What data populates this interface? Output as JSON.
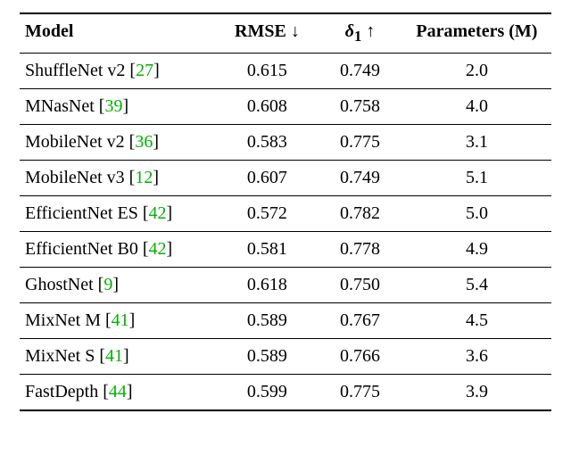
{
  "headers": {
    "model": "Model",
    "rmse": "RMSE",
    "rmse_arrow": "↓",
    "delta": "δ",
    "delta_sub": "1",
    "delta_arrow": "↑",
    "params": "Parameters (M)"
  },
  "rows": [
    {
      "name": "ShuffleNet v2",
      "cite": "27",
      "rmse": "0.615",
      "delta": "0.749",
      "params": "2.0"
    },
    {
      "name": "MNasNet",
      "cite": "39",
      "rmse": "0.608",
      "delta": "0.758",
      "params": "4.0"
    },
    {
      "name": "MobileNet v2",
      "cite": "36",
      "rmse": "0.583",
      "delta": "0.775",
      "params": "3.1"
    },
    {
      "name": "MobileNet v3",
      "cite": "12",
      "rmse": "0.607",
      "delta": "0.749",
      "params": "5.1"
    },
    {
      "name": "EfficientNet ES",
      "cite": "42",
      "rmse": "0.572",
      "delta": "0.782",
      "params": "5.0"
    },
    {
      "name": "EfficientNet B0",
      "cite": "42",
      "rmse": "0.581",
      "delta": "0.778",
      "params": "4.9"
    },
    {
      "name": "GhostNet",
      "cite": "9",
      "rmse": "0.618",
      "delta": "0.750",
      "params": "5.4"
    },
    {
      "name": "MixNet M",
      "cite": "41",
      "rmse": "0.589",
      "delta": "0.767",
      "params": "4.5"
    },
    {
      "name": "MixNet S",
      "cite": "41",
      "rmse": "0.589",
      "delta": "0.766",
      "params": "3.6"
    },
    {
      "name": "FastDepth",
      "cite": "44",
      "rmse": "0.599",
      "delta": "0.775",
      "params": "3.9"
    }
  ],
  "chart_data": {
    "type": "table",
    "title": "Model comparison: RMSE, δ1, Parameters (M)",
    "columns": [
      "Model",
      "RMSE (↓)",
      "δ1 (↑)",
      "Parameters (M)"
    ],
    "rows": [
      [
        "ShuffleNet v2 [27]",
        0.615,
        0.749,
        2.0
      ],
      [
        "MNasNet [39]",
        0.608,
        0.758,
        4.0
      ],
      [
        "MobileNet v2 [36]",
        0.583,
        0.775,
        3.1
      ],
      [
        "MobileNet v3 [12]",
        0.607,
        0.749,
        5.1
      ],
      [
        "EfficientNet ES [42]",
        0.572,
        0.782,
        5.0
      ],
      [
        "EfficientNet B0 [42]",
        0.581,
        0.778,
        4.9
      ],
      [
        "GhostNet [9]",
        0.618,
        0.75,
        5.4
      ],
      [
        "MixNet M [41]",
        0.589,
        0.767,
        4.5
      ],
      [
        "MixNet S [41]",
        0.589,
        0.766,
        3.6
      ],
      [
        "FastDepth [44]",
        0.599,
        0.775,
        3.9
      ]
    ]
  }
}
